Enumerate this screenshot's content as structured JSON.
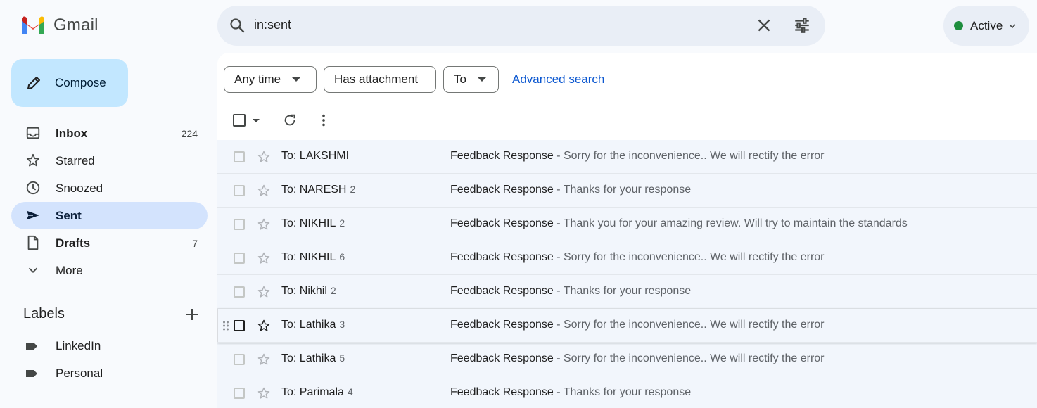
{
  "app": {
    "name": "Gmail"
  },
  "search": {
    "value": "in:sent"
  },
  "status": {
    "label": "Active",
    "color": "#1e8e3e"
  },
  "compose": {
    "label": "Compose"
  },
  "nav": [
    {
      "label": "Inbox",
      "count": "224",
      "icon": "inbox-icon",
      "bold": true
    },
    {
      "label": "Starred",
      "count": "",
      "icon": "star-icon"
    },
    {
      "label": "Snoozed",
      "count": "",
      "icon": "clock-icon"
    },
    {
      "label": "Sent",
      "count": "",
      "icon": "send-icon",
      "active": true
    },
    {
      "label": "Drafts",
      "count": "7",
      "icon": "draft-icon",
      "bold": true
    },
    {
      "label": "More",
      "count": "",
      "icon": "chevron-down-icon"
    }
  ],
  "labels": {
    "title": "Labels",
    "items": [
      {
        "name": "LinkedIn",
        "icon": "label-icon"
      },
      {
        "name": "Personal",
        "icon": "label-icon"
      }
    ]
  },
  "filters": {
    "any_time": "Any time",
    "has_attachment": "Has attachment",
    "to": "To",
    "advanced": "Advanced search"
  },
  "emails": [
    {
      "to": "To: LAKSHMI",
      "count": "",
      "subject": "Feedback Response",
      "snippet": "Sorry for the inconvenience.. We will rectify the error"
    },
    {
      "to": "To: NARESH",
      "count": "2",
      "subject": "Feedback Response",
      "snippet": "Thanks for your response"
    },
    {
      "to": "To: NIKHIL",
      "count": "2",
      "subject": "Feedback Response",
      "snippet": "Thank you for your amazing review. Will try to maintain the standards"
    },
    {
      "to": "To: NIKHIL",
      "count": "6",
      "subject": "Feedback Response",
      "snippet": "Sorry for the inconvenience.. We will rectify the error"
    },
    {
      "to": "To: Nikhil",
      "count": "2",
      "subject": "Feedback Response",
      "snippet": "Thanks for your response"
    },
    {
      "to": "To: Lathika",
      "count": "3",
      "subject": "Feedback Response",
      "snippet": "Sorry for the inconvenience.. We will rectify the error",
      "hover": true
    },
    {
      "to": "To: Lathika",
      "count": "5",
      "subject": "Feedback Response",
      "snippet": "Sorry for the inconvenience.. We will rectify the error"
    },
    {
      "to": "To: Parimala",
      "count": "4",
      "subject": "Feedback Response",
      "snippet": "Thanks for your response"
    }
  ]
}
